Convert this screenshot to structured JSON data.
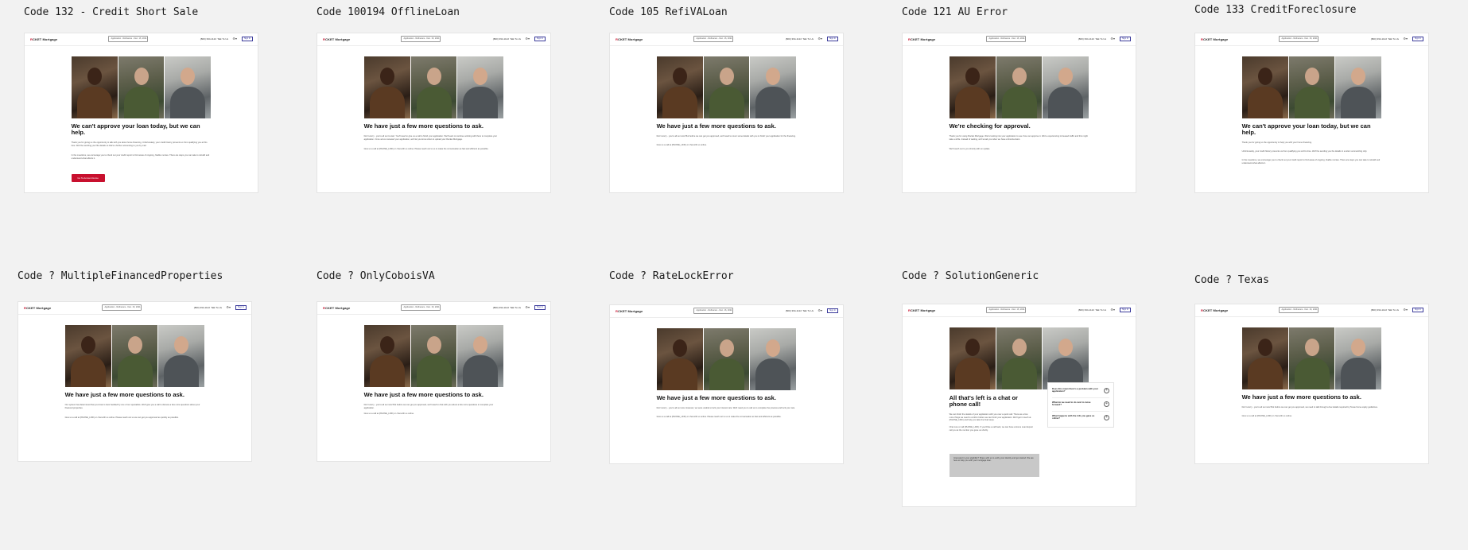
{
  "header": {
    "logo_prefix": "R",
    "logo_rest": "CKET Mortgage",
    "app_selector": "Application - Refinance - Dec. 16, 2021",
    "phone": "(800) 394-1122",
    "talk": "Talk To Us",
    "icon": "settings-icon",
    "sign_in": "Sign In"
  },
  "colors": {
    "brand_red": "#c8102e",
    "sign_in_blue": "#3b3b9b",
    "background": "#f2f2f2"
  },
  "frames": [
    {
      "title": "Code 132 - Credit Short Sale",
      "heading": "We can't approve your loan today, but we can help.",
      "paragraphs": [
        "Thank you for giving us the opportunity to talk with you about home financing. Unfortunately, your credit history prevents us from qualifying you at this time. We'll be sending your file details so that's a further accounting to you by mail.",
        "In the meantime, we encourage you to check out your credit report to find areas of ongoing, fixable monies. There are steps you can take to rebuild and understand what affects it."
      ],
      "cta": "Go To Account Home"
    },
    {
      "title": "Code 100194 OfflineLoan",
      "heading": "We have just a few more questions to ask.",
      "paragraphs": [
        "Don't worry - you're all set to start. You'll need to give us a call to finish your application. We'll want to continue working with them to complete your application. Once we've reviewed your application, we'll let you know when to upload your Rocket Mortgage.",
        "Give us a call at (PHONE_LINK) or chat with us online. Please reach out to us to make the conversation as fast and efficient as possible."
      ]
    },
    {
      "title": "Code 105 RefiVALoan",
      "heading": "We have just a few more questions to ask.",
      "paragraphs": [
        "Don't worry - you're all set now! But before we can get you approved, we'll need to cover some details with you to finish your application for the financing.",
        "Give us a call at (PHONE_LINK) or chat with us online."
      ]
    },
    {
      "title": "Code 121 AU Error",
      "heading": "We're checking for approval.",
      "paragraphs": [
        "Thank you for using Rocket Mortgage. We're looking into your application to see if we can approve it. We're experiencing increased traffic and this might take a while. Instead of waiting, we'll email you when we have a final decision.",
        "We'll reach out to you shortly with an update."
      ]
    },
    {
      "title": "Code 133 CreditForeclosure",
      "heading": "We can't approve your loan today, but we can help.",
      "paragraphs": [
        "Thank you for giving us the opportunity to help you with your home financing.",
        "Unfortunately, your credit history prevents us from qualifying you at this time. We'll be sending you the details in a letter summarizing why.",
        "In the meantime, we encourage you to check out your credit report to find areas of ongoing, fixable monies. There are steps you can take to rebuild and understand what affects it."
      ]
    },
    {
      "title": "Code ? MultipleFinancedProperties",
      "heading": "We have just a few more questions to ask.",
      "paragraphs": [
        "Our system has determined that your loan is best handled by one of our specialists. We'll give you a call to discuss a few more questions about your financed properties.",
        "Give us a call at (PHONE_LINK) or chat with us online. Please reach out so we can get you approved as quickly as possible."
      ]
    },
    {
      "title": "Code ? OnlyCoboisVA",
      "heading": "We have just a few more questions to ask.",
      "paragraphs": [
        "Don't worry - you're all set now! But before we can get you approved, we'll need to chat with you about a few more questions to complete your application.",
        "Give us a call at (PHONE_LINK) or chat with us online."
      ]
    },
    {
      "title": "Code ? RateLockError",
      "heading": "We have just a few more questions to ask.",
      "paragraphs": [
        "Don't worry - you're all set now. However, we were unable to lock your interest rate. We'll need you to call us to complete the process and lock your rate.",
        "Give us a call at (PHONE_LINK) or chat with us online. Please reach out to us to make the conversation as fast and efficient as possible."
      ]
    },
    {
      "title": "Code ? SolutionGeneric",
      "heading": "All that's left is a chat or phone call!",
      "paragraphs": [
        "We can finish the details of your application with you over a quick call. There are a few more things we need to confirm before we can finish your application. We'll get in touch at (PHONE_LINK) and help you take the final steps.",
        "Chat now or call (PHONE_LINK). If you'd like a call back, we can have a Home Loan Expert call you at the number you gave us shortly."
      ],
      "faq": [
        "Does this mean there's a problem with your application?",
        "What do we need to do next to move forward?",
        "What happens with the info you gave us online?"
      ],
      "notice": "Interested in your eligibility? Share with us to verify your identity and get started. We are here to help you with your mortgage loan."
    },
    {
      "title": "Code ? Texas",
      "heading": "We have just a few more questions to ask.",
      "paragraphs": [
        "Don't worry - you're all set now! But before we can get you approved, we need to talk through a few details required by Texas home equity guidelines.",
        "Give us a call at (PHONE_LINK) or chat with us online."
      ]
    }
  ]
}
